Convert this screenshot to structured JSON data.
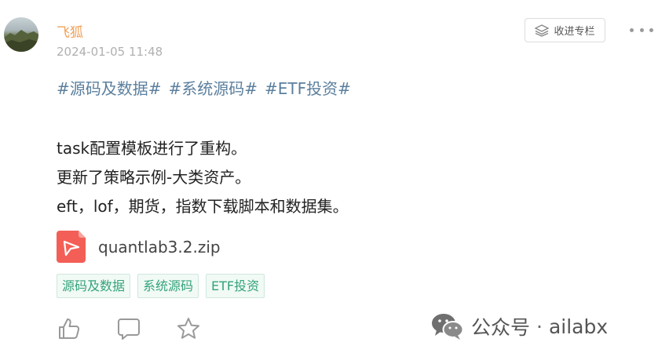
{
  "post": {
    "author": "飞狐",
    "timestamp": "2024-01-05 11:48",
    "collect_button_label": "收进专栏",
    "hashtags": [
      "#源码及数据#",
      "#系统源码#",
      "#ETF投资#"
    ],
    "body_lines": [
      "task配置模板进行了重构。",
      "更新了策略示例-大类资产。",
      "eft，lof，期货，指数下载脚本和数据集。"
    ],
    "attachment": {
      "file_name": "quantlab3.2.zip",
      "icon": "pdf-style-file-icon",
      "icon_color": "#f35f56"
    },
    "tags": [
      "源码及数据",
      "系统源码",
      "ETF投资"
    ],
    "actions": [
      "like-icon",
      "comment-icon",
      "star-icon"
    ]
  },
  "watermark": {
    "brand": "公众号",
    "separator": "·",
    "account": "ailabx"
  },
  "colors": {
    "author": "#f0a15a",
    "hashtag": "#5b7f9e",
    "tag_text": "#34a37a",
    "tag_bg": "#f1faf5"
  }
}
